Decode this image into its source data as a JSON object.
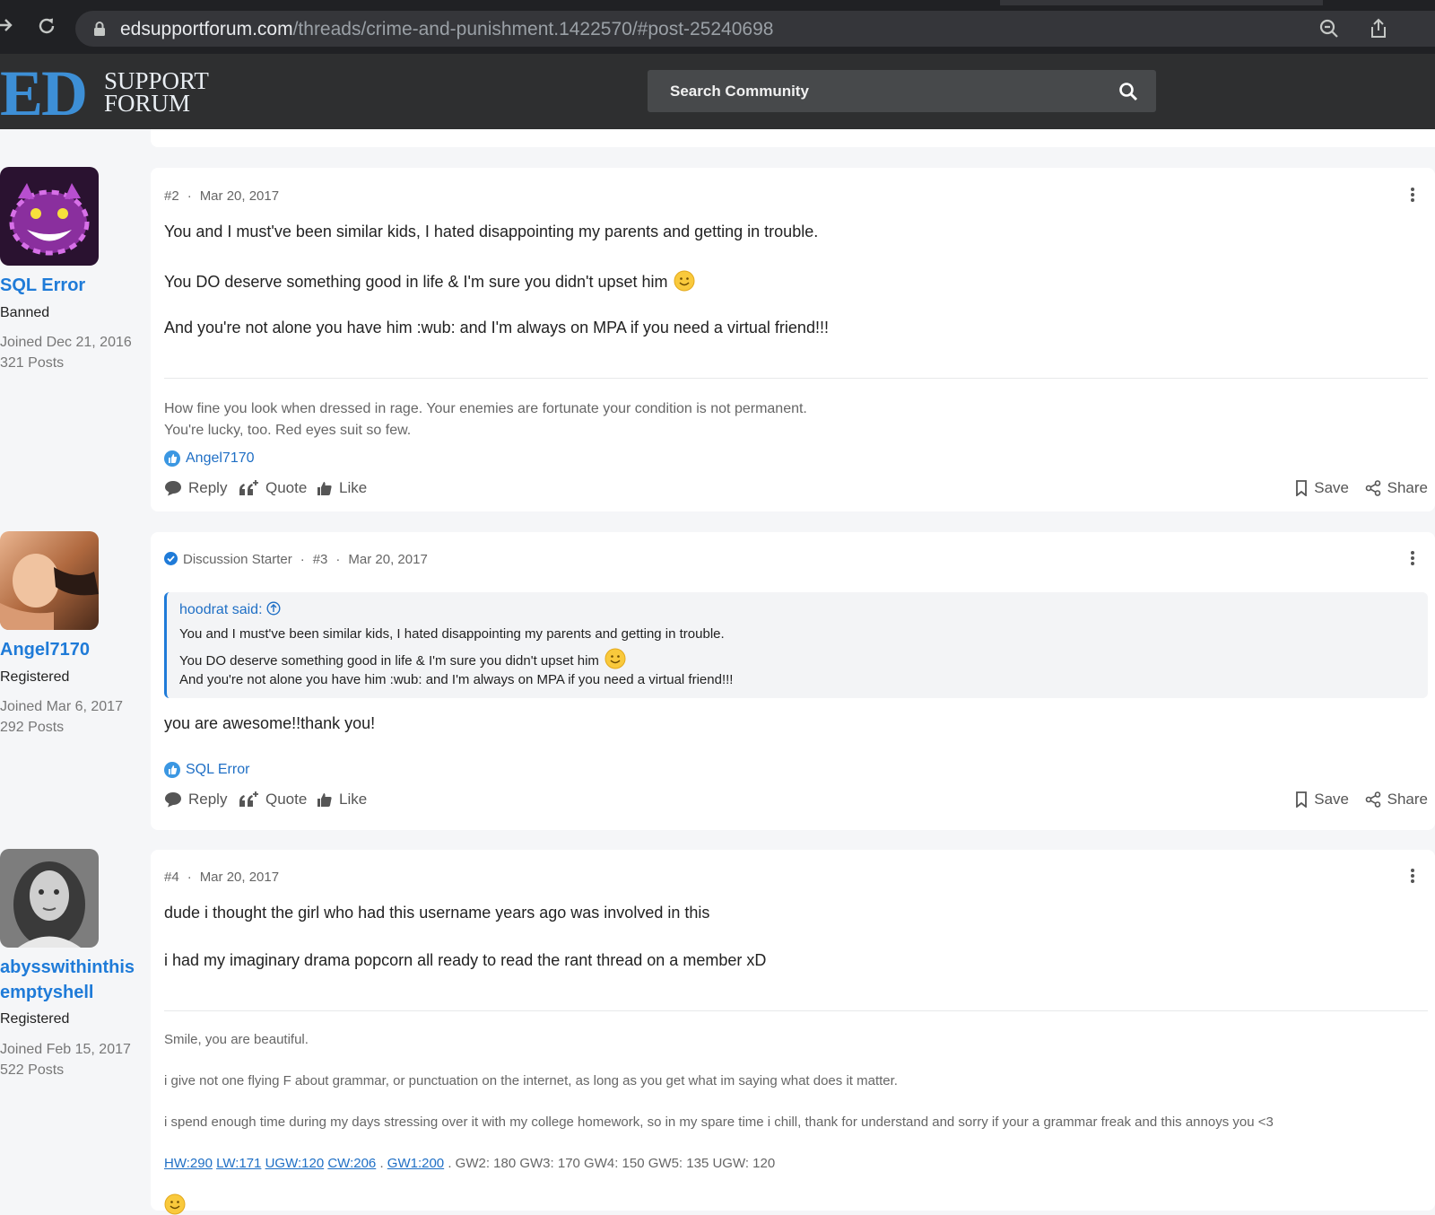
{
  "browser": {
    "url_domain": "edsupportforum.com",
    "url_path": "/threads/crime-and-punishment.1422570/#post-25240698"
  },
  "site": {
    "logo_mark": "ED",
    "logo_line1": "SUPPORT",
    "logo_line2": "FORUM",
    "search_placeholder": "Search Community"
  },
  "actions": {
    "reply": "Reply",
    "quote": "Quote",
    "like": "Like",
    "save": "Save",
    "share": "Share"
  },
  "posts": [
    {
      "author": "SQL Error",
      "role": "Banned",
      "joined": "Joined Dec 21, 2016",
      "posts": "321 Posts",
      "number": "#2",
      "date": "Mar 20, 2017",
      "body": [
        "You and I must've been similar kids, I hated disappointing my parents and getting in trouble.",
        "You DO deserve something good in life & I'm sure you didn't upset him",
        "And you're not alone you have him :wub: and I'm always on MPA if you need a virtual friend!!!"
      ],
      "signature": [
        "How fine you look when dressed in rage. Your enemies are fortunate your condition is not permanent.",
        "You're lucky, too. Red eyes suit so few."
      ],
      "liked_by": "Angel7170"
    },
    {
      "author": "Angel7170",
      "role": "Registered",
      "joined": "Joined Mar 6, 2017",
      "posts": "292 Posts",
      "starter_label": "Discussion Starter",
      "number": "#3",
      "date": "Mar 20, 2017",
      "quote_author": "hoodrat said:",
      "quote_lines": [
        "You and I must've been similar kids, I hated disappointing my parents and getting in trouble.",
        "You DO deserve something good in life & I'm sure you didn't upset him",
        "And you're not alone you have him :wub: and I'm always on MPA if you need a virtual friend!!!"
      ],
      "body": [
        "you are awesome!!thank you!"
      ],
      "liked_by": "SQL Error"
    },
    {
      "author_line1": "abysswithinthis",
      "author_line2": "emptyshell",
      "role": "Registered",
      "joined": "Joined Feb 15, 2017",
      "posts": "522 Posts",
      "number": "#4",
      "date": "Mar 20, 2017",
      "body": [
        "dude i thought the girl who had this username years ago was involved in this",
        "i had my imaginary drama popcorn all ready to read the rant thread on a member xD"
      ],
      "signature": [
        "Smile, you are beautiful.",
        "i give not one flying F about grammar, or punctuation on the internet, as long as you get what im saying what does it matter.",
        "i spend enough time during my days stressing over it with my college homework, so in my spare time i chill, thank for understand and sorry if your a grammar freak and this annoys you <3"
      ],
      "sig_links": [
        "HW:290",
        "LW:171",
        "UGW:120",
        "CW:206",
        "GW1:200"
      ],
      "sig_sep": ".",
      "sig_tail": ". GW2: 180 GW3: 170 GW4: 150 GW5: 135 UGW: 120"
    }
  ],
  "colors": {
    "accent": "#1f7bd8",
    "header_bg": "#2e2f30",
    "browser_bg": "#202124"
  }
}
